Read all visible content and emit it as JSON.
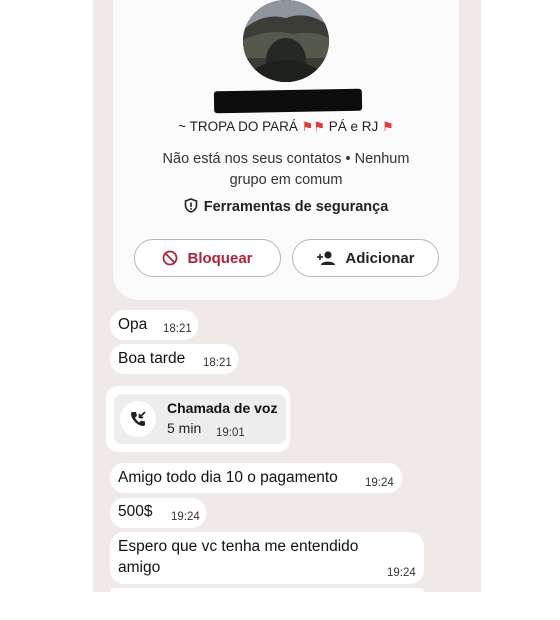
{
  "profile": {
    "status": "~ TROPA DO PARÁ",
    "status_part2": "PÁ e RJ",
    "info_line1": "Não está nos seus contatos  •  Nenhum",
    "info_line2": "grupo em comum",
    "security_label": "Ferramentas de segurança",
    "block_label": "Bloquear",
    "add_label": "Adicionar"
  },
  "messages": [
    {
      "text": "Opa",
      "time": "18:21"
    },
    {
      "text": "Boa tarde",
      "time": "18:21"
    },
    {
      "call_title": "Chamada de voz",
      "call_duration": "5 min",
      "time": "19:01"
    },
    {
      "text": "Amigo todo dia 10 o pagamento",
      "time": "19:24"
    },
    {
      "text": "500$",
      "time": "19:24"
    },
    {
      "text_line1": "Espero que vc tenha me entendido",
      "text_line2": "amigo",
      "time": "19:24"
    }
  ],
  "colors": {
    "chat_background": "#efeae8",
    "block_red": "#b0223a",
    "flag_red": "#e53935"
  },
  "icons": [
    "shield-icon",
    "block-icon",
    "add-person-icon",
    "incoming-call-icon",
    "red-flag-icon"
  ]
}
